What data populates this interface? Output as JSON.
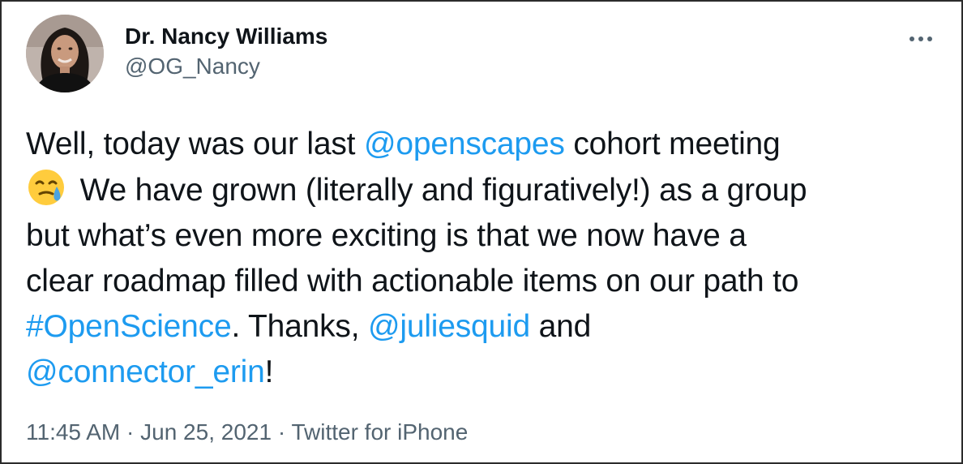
{
  "tweet": {
    "author": {
      "display_name": "Dr. Nancy Williams",
      "handle": "@OG_Nancy"
    },
    "more_icon": "more-horizontal-icon",
    "text": {
      "line1_a": "Well, today was our last ",
      "mention_openscapes": "@openscapes",
      "line1_b": " cohort meeting",
      "emoji": "sad-but-relieved-face",
      "line2": " We have grown (literally and figuratively!) as a group",
      "line3": "but what’s even more exciting is that we now have a",
      "line4": "clear roadmap filled with actionable items on our path to",
      "hashtag": "#OpenScience",
      "line5_a": ". Thanks, ",
      "mention_juliesquid": "@juliesquid",
      "line5_b": " and",
      "mention_connector_erin": "@connector_erin",
      "line6_b": "!"
    },
    "meta": {
      "time": "11:45 AM",
      "separator1": " · ",
      "date": "Jun 25, 2021",
      "separator2": " · ",
      "source": "Twitter for iPhone"
    },
    "colors": {
      "link": "#1d9bf0",
      "text": "#0f1419",
      "secondary": "#536471"
    }
  }
}
